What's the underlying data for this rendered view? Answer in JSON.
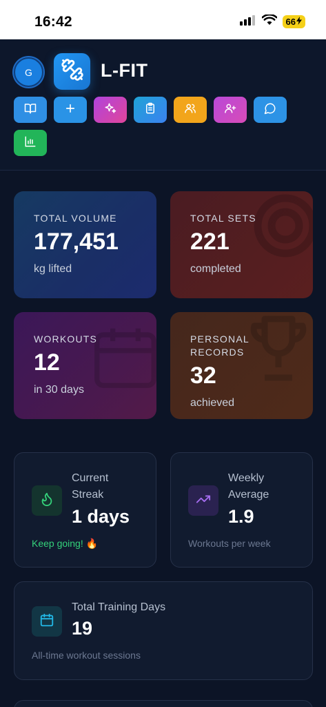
{
  "status_bar": {
    "time": "16:42",
    "battery": "66"
  },
  "header": {
    "avatar_initial": "G",
    "app_name": "L-FIT",
    "nav_buttons": [
      {
        "icon": "book-open-icon",
        "color": "#2f8fe4"
      },
      {
        "icon": "plus-icon",
        "color": "#2a93e6"
      },
      {
        "icon": "sparkles-icon",
        "color": "#c544d8"
      },
      {
        "icon": "clipboard-icon",
        "color": "#2897df"
      },
      {
        "icon": "users-icon",
        "color": "#f2a51b"
      },
      {
        "icon": "user-plus-icon",
        "color": "#b94ad8"
      },
      {
        "icon": "chat-icon",
        "color": "#2d93e6"
      },
      {
        "icon": "bar-chart-icon",
        "color": "#22b559"
      }
    ]
  },
  "stats": [
    {
      "label": "TOTAL VOLUME",
      "value": "177,451",
      "sub": "kg lifted"
    },
    {
      "label": "TOTAL SETS",
      "value": "221",
      "sub": "completed"
    },
    {
      "label": "WORKOUTS",
      "value": "12",
      "sub": "in 30 days"
    },
    {
      "label": "PERSONAL\nRECORDS",
      "value": "32",
      "sub": "achieved"
    }
  ],
  "streak": {
    "label": "Current\nStreak",
    "value": "1 days",
    "footer": "Keep going! 🔥"
  },
  "weekly": {
    "label": "Weekly\nAverage",
    "value": "1.9",
    "footer": "Workouts per week"
  },
  "training": {
    "label": "Total Training Days",
    "value": "19",
    "footer": "All-time workout sessions"
  }
}
